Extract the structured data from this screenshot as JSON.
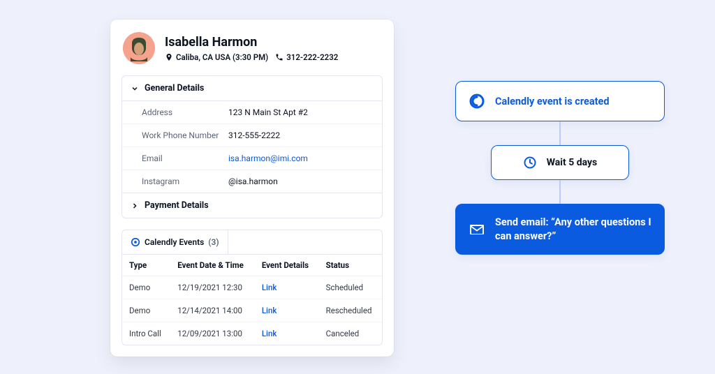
{
  "contact": {
    "name": "Isabella Harmon",
    "location": "Caliba, CA USA (3:30 PM)",
    "phone": "312-222-2232"
  },
  "panels": {
    "general": {
      "title": "General Details",
      "rows": {
        "address": {
          "label": "Address",
          "value": "123 N Main St Apt #2"
        },
        "workPhone": {
          "label": "Work Phone Number",
          "value": "312-555-2222"
        },
        "email": {
          "label": "Email",
          "value": "isa.harmon@imi.com"
        },
        "instagram": {
          "label": "Instagram",
          "value": "@isa.harmon"
        }
      }
    },
    "payment": {
      "title": "Payment Details"
    }
  },
  "events": {
    "tab_label": "Calendly Events",
    "count": "(3)",
    "headers": {
      "type": "Type",
      "dt": "Event Date & Time",
      "details": "Event Details",
      "status": "Status"
    },
    "link_label": "Link",
    "rows": [
      {
        "type": "Demo",
        "dt": "12/19/2021 12:30",
        "status": "Scheduled"
      },
      {
        "type": "Demo",
        "dt": "12/14/2021 14:00",
        "status": "Rescheduled"
      },
      {
        "type": "Intro Call",
        "dt": "12/09/2021 13:00",
        "status": "Canceled"
      }
    ]
  },
  "workflow": {
    "trigger": "Calendly event is created",
    "wait": "Wait 5 days",
    "action": "Send email: “Any other questions I can answer?”"
  },
  "colors": {
    "accent": "#0a5be0"
  }
}
